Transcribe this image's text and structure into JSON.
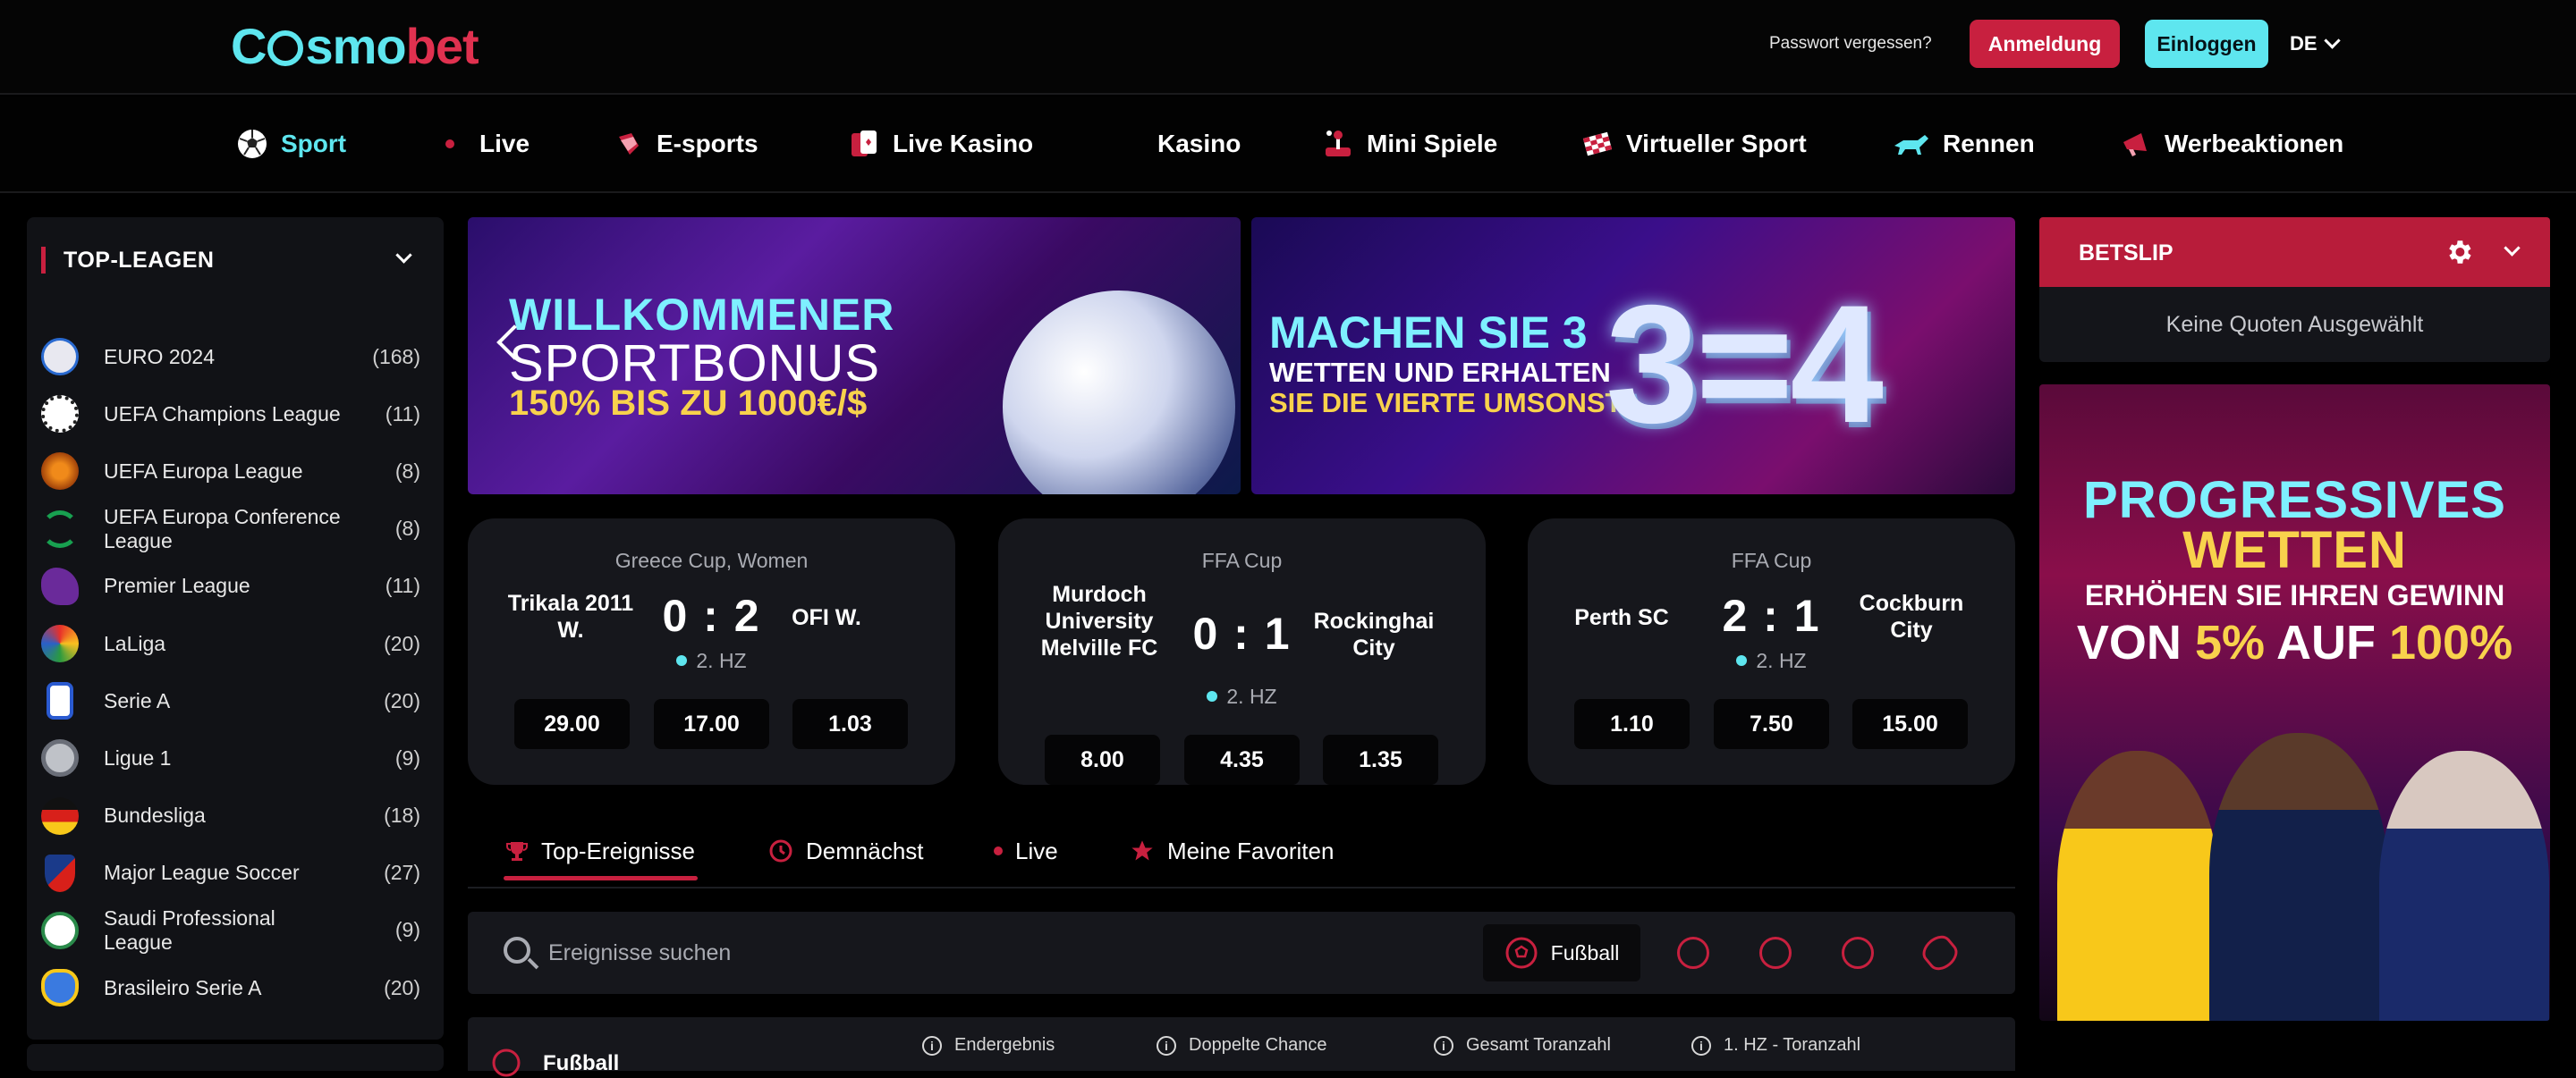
{
  "header": {
    "logo": {
      "part1": "C",
      "part2": "smo",
      "part3": "bet"
    },
    "forgot_password": "Passwort vergessen?",
    "register_label": "Anmeldung",
    "login_label": "Einloggen",
    "language": "DE"
  },
  "nav": {
    "items": [
      {
        "label": "Sport",
        "icon": "soccer-ball-icon"
      },
      {
        "label": "Live",
        "icon": "live-dot-icon"
      },
      {
        "label": "E-sports",
        "icon": "gamepad-icon"
      },
      {
        "label": "Live Kasino",
        "icon": "cards-icon"
      },
      {
        "label": "Kasino",
        "icon": "casino-icon"
      },
      {
        "label": "Mini Spiele",
        "icon": "joystick-icon"
      },
      {
        "label": "Virtueller Sport",
        "icon": "checkered-flag-icon"
      },
      {
        "label": "Rennen",
        "icon": "horse-icon"
      },
      {
        "label": "Werbeaktionen",
        "icon": "megaphone-icon"
      }
    ],
    "active_color": "#5ee6ef"
  },
  "sidebar": {
    "title": "TOP-LEAGEN",
    "items": [
      {
        "name": "EURO 2024",
        "count": "(168)",
        "icon": "euro-2024-icon"
      },
      {
        "name": "UEFA Champions League",
        "count": "(11)",
        "icon": "champions-league-icon"
      },
      {
        "name": "UEFA Europa League",
        "count": "(8)",
        "icon": "europa-league-icon"
      },
      {
        "name": "UEFA Europa Conference League",
        "count": "(8)",
        "icon": "conference-league-icon"
      },
      {
        "name": "Premier League",
        "count": "(11)",
        "icon": "premier-league-icon"
      },
      {
        "name": "LaLiga",
        "count": "(20)",
        "icon": "laliga-icon"
      },
      {
        "name": "Serie A",
        "count": "(20)",
        "icon": "serie-a-icon"
      },
      {
        "name": "Ligue 1",
        "count": "(9)",
        "icon": "ligue-1-icon"
      },
      {
        "name": "Bundesliga",
        "count": "(18)",
        "icon": "german-flag-icon"
      },
      {
        "name": "Major League Soccer",
        "count": "(27)",
        "icon": "mls-icon"
      },
      {
        "name": "Saudi Professional League",
        "count": "(9)",
        "icon": "saudi-league-icon"
      },
      {
        "name": "Brasileiro Serie A",
        "count": "(20)",
        "icon": "brasileiro-icon"
      }
    ]
  },
  "banners": {
    "b1": {
      "line1": "WILLKOMMENER",
      "line2": "SPORTBONUS",
      "line3": "150% BIS ZU 1000€/$"
    },
    "b2": {
      "line1": "MACHEN SIE 3",
      "line2": "WETTEN UND ERHALTEN",
      "line3": "SIE DIE VIERTE UMSONST",
      "big": "3=4"
    }
  },
  "matches": [
    {
      "competition": "Greece Cup, Women",
      "home": "Trikala 2011 W.",
      "away": "OFI W.",
      "score": "0 : 2",
      "period": "2. HZ",
      "odds": [
        "29.00",
        "17.00",
        "1.03"
      ]
    },
    {
      "competition": "FFA Cup",
      "home": "Murdoch University Melville FC",
      "away": "Rockinghai City",
      "score": "0 : 1",
      "period": "2. HZ",
      "odds": [
        "8.00",
        "4.35",
        "1.35"
      ]
    },
    {
      "competition": "FFA Cup",
      "home": "Perth SC",
      "away": "Cockburn City",
      "score": "2 : 1",
      "period": "2. HZ",
      "odds": [
        "1.10",
        "7.50",
        "15.00"
      ]
    }
  ],
  "tabs": [
    {
      "label": "Top-Ereignisse",
      "icon": "trophy-icon"
    },
    {
      "label": "Demnächst",
      "icon": "clock-icon"
    },
    {
      "label": "Live",
      "icon": "live-dot-icon"
    },
    {
      "label": "Meine Favoriten",
      "icon": "star-icon"
    }
  ],
  "search": {
    "placeholder": "Ereignisse suchen",
    "active_sport": "Fußball"
  },
  "events_header": {
    "sport": "Fußball",
    "columns": [
      "Endergebnis",
      "Doppelte Chance",
      "Gesamt Toranzahl",
      "1. HZ - Toranzahl"
    ]
  },
  "betslip": {
    "title": "BETSLIP",
    "empty": "Keine Quoten Ausgewählt"
  },
  "promo": {
    "line1": "PROGRESSIVES",
    "line2": "WETTEN",
    "line3": "ERHÖHEN SIE IHREN GEWINN",
    "line4_a": "VON ",
    "line4_b": "5%",
    "line4_c": " AUF ",
    "line4_d": "100%"
  },
  "colors": {
    "accent": "#5ee6ef",
    "brand": "#c8203f",
    "card": "#16171c",
    "sidebar": "#111216"
  }
}
